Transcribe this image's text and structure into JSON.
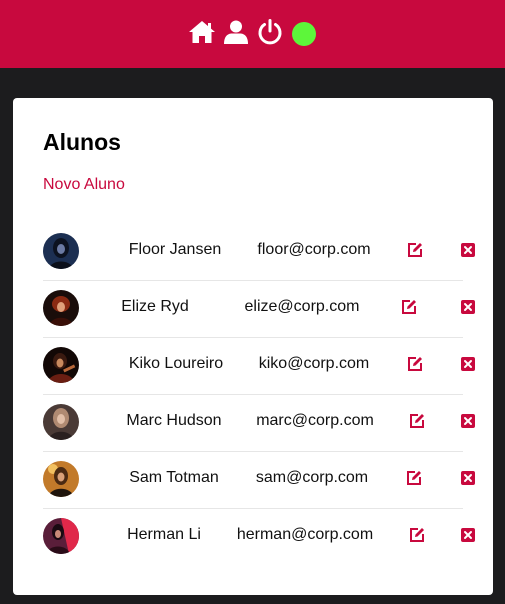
{
  "header": {
    "icons": [
      "home-icon",
      "user-icon",
      "power-icon",
      "online-status-indicator"
    ],
    "accent": "#c8093e",
    "status_color": "#5df63a"
  },
  "card": {
    "title": "Alunos",
    "new_link": "Novo Aluno"
  },
  "students": [
    {
      "name": "Floor Jansen",
      "email": "floor@corp.com",
      "edit_icon": "edit-icon",
      "delete_icon": "delete-icon"
    },
    {
      "name": "Elize Ryd",
      "email": "elize@corp.com",
      "edit_icon": "edit-icon",
      "delete_icon": "delete-icon"
    },
    {
      "name": "Kiko Loureiro",
      "email": "kiko@corp.com",
      "edit_icon": "edit-icon",
      "delete_icon": "delete-icon"
    },
    {
      "name": "Marc Hudson",
      "email": "marc@corp.com",
      "edit_icon": "edit-icon",
      "delete_icon": "delete-icon"
    },
    {
      "name": "Sam Totman",
      "email": "sam@corp.com",
      "edit_icon": "edit-icon",
      "delete_icon": "delete-icon"
    },
    {
      "name": "Herman Li",
      "email": "herman@corp.com",
      "edit_icon": "edit-icon",
      "delete_icon": "delete-icon"
    }
  ]
}
